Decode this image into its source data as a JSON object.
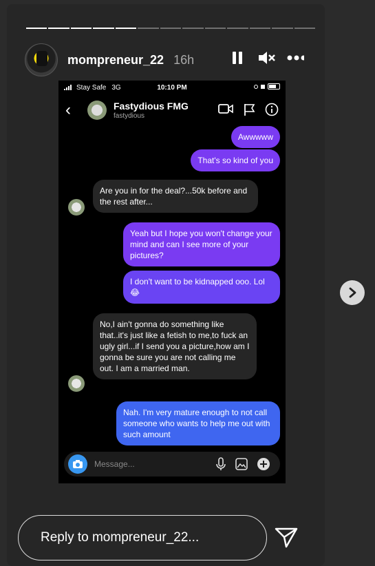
{
  "story": {
    "username": "mompreneur_22",
    "time": "16h",
    "reply_placeholder": "Reply to mompreneur_22...",
    "progress_segments_done": 5,
    "progress_segments_total": 13
  },
  "phone": {
    "carrier": "Stay Safe",
    "network": "3G",
    "clock": "10:10 PM"
  },
  "dm": {
    "name": "Fastydious FMG",
    "handle": "fastydious",
    "composer_placeholder": "Message..."
  },
  "messages": [
    {
      "side": "sent",
      "text": "Awwwww"
    },
    {
      "side": "sent",
      "text": "That's so kind of you"
    },
    {
      "side": "recv",
      "text": "Are you in for the deal?...50k before and the rest after..."
    },
    {
      "side": "sent",
      "text": "Yeah but I hope you won't change your mind and can I see more of your pictures?"
    },
    {
      "side": "sent",
      "text": "I don't want to be kidnapped ooo. Lol 😂"
    },
    {
      "side": "recv",
      "text": "No,I ain't gonna do something like that..it's just like a fetish to me,to fuck an ugly girl...if I send you a picture,how am I gonna be sure you are not calling me out. I am a married man."
    },
    {
      "side": "sent",
      "text": "Nah. I'm very mature enough to not call someone who wants to help me out with such amount"
    }
  ],
  "colors": {
    "sent_purple": "#7a3bf2",
    "sent_blue": "#3f66f0",
    "received": "#262626",
    "background": "#2b2b2b"
  },
  "icons": [
    "pause-icon",
    "mute-icon",
    "more-icon",
    "back-icon",
    "video-call-icon",
    "flag-icon",
    "info-icon",
    "camera-icon",
    "microphone-icon",
    "gallery-icon",
    "plus-icon",
    "next-story-icon",
    "send-icon"
  ]
}
